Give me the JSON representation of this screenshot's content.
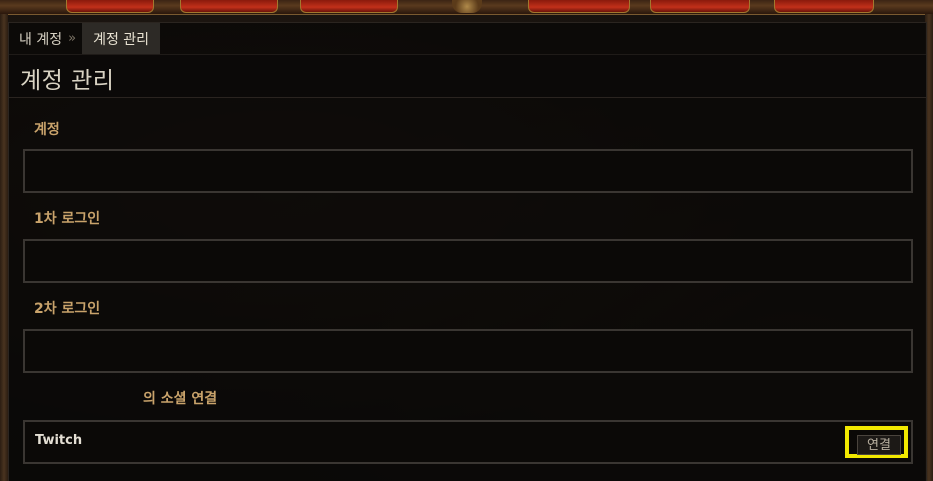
{
  "breadcrumb": {
    "home": "내 계정",
    "separator": "»",
    "current": "계정 관리"
  },
  "page_title": "계정 관리",
  "fields": [
    {
      "label": "계정",
      "value": ""
    },
    {
      "label": "1차 로그인",
      "value": ""
    },
    {
      "label": "2차 로그인",
      "value": ""
    }
  ],
  "social": {
    "header": "의 소셜 연결",
    "items": [
      {
        "name": "Twitch",
        "action": "연결"
      }
    ]
  },
  "colors": {
    "label_gold": "#c9a36b",
    "highlight": "#f2e900",
    "nav_red": "#c2301a"
  }
}
